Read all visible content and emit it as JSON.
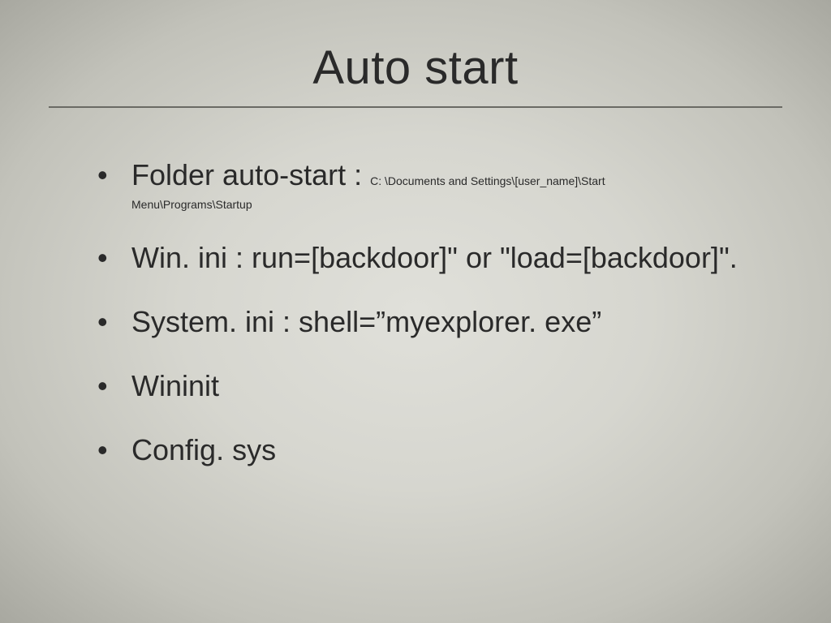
{
  "title": "Auto start",
  "bullets": [
    {
      "main": "Folder auto-start : ",
      "detail": "C: \\Documents and Settings\\[user_name]\\Start",
      "detail2": "Menu\\Programs\\Startup"
    },
    {
      "main": "Win. ini : run=[backdoor]\" or \"load=[backdoor]\"."
    },
    {
      "main": "System. ini : shell=”myexplorer. exe”"
    },
    {
      "main": "Wininit"
    },
    {
      "main": "Config. sys"
    }
  ]
}
